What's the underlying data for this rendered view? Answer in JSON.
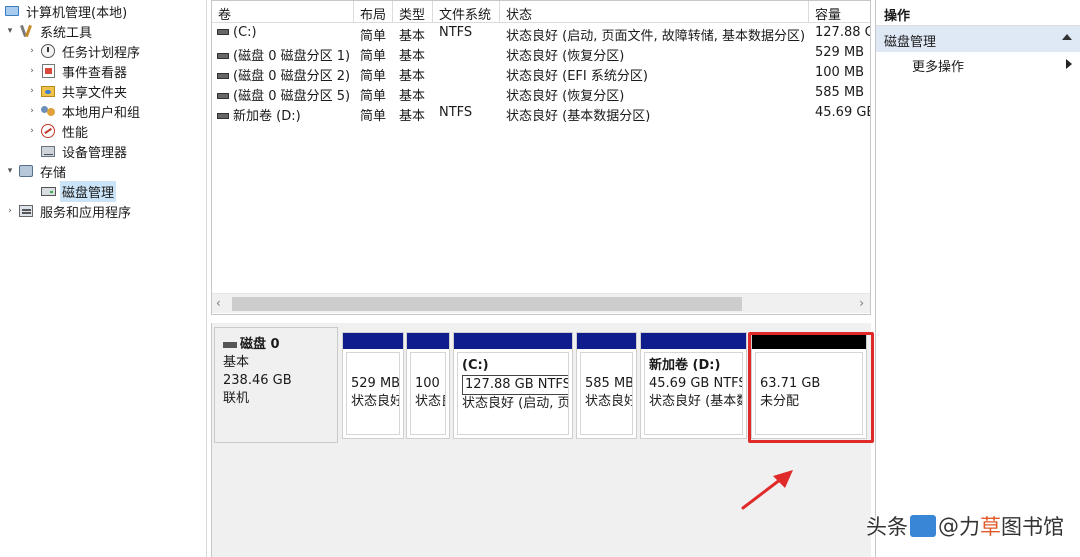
{
  "tree": {
    "items": [
      {
        "label": "计算机管理(本地)",
        "icon": "computer-icon",
        "level": 0,
        "expander": ""
      },
      {
        "label": "系统工具",
        "icon": "tools-icon",
        "level": 1,
        "expander": "expanded"
      },
      {
        "label": "任务计划程序",
        "icon": "clock-icon",
        "level": 2,
        "expander": "collapsed"
      },
      {
        "label": "事件查看器",
        "icon": "event-viewer-icon",
        "level": 2,
        "expander": "collapsed"
      },
      {
        "label": "共享文件夹",
        "icon": "shared-folder-icon",
        "level": 2,
        "expander": "collapsed"
      },
      {
        "label": "本地用户和组",
        "icon": "users-icon",
        "level": 2,
        "expander": "collapsed"
      },
      {
        "label": "性能",
        "icon": "performance-icon",
        "level": 2,
        "expander": "collapsed"
      },
      {
        "label": "设备管理器",
        "icon": "device-manager-icon",
        "level": 2,
        "expander": ""
      },
      {
        "label": "存储",
        "icon": "storage-icon",
        "level": 1,
        "expander": "expanded"
      },
      {
        "label": "磁盘管理",
        "icon": "disk-icon",
        "level": 2,
        "expander": "",
        "selected": true
      },
      {
        "label": "服务和应用程序",
        "icon": "services-icon",
        "level": 1,
        "expander": "collapsed"
      }
    ]
  },
  "volumes": {
    "columns": [
      "卷",
      "布局",
      "类型",
      "文件系统",
      "状态",
      "容量"
    ],
    "rows": [
      {
        "name": "(C:)",
        "layout": "简单",
        "type": "基本",
        "fs": "NTFS",
        "status": "状态良好 (启动, 页面文件, 故障转储, 基本数据分区)",
        "capacity": "127.88 G"
      },
      {
        "name": "(磁盘 0 磁盘分区 1)",
        "layout": "简单",
        "type": "基本",
        "fs": "",
        "status": "状态良好 (恢复分区)",
        "capacity": "529 MB"
      },
      {
        "name": "(磁盘 0 磁盘分区 2)",
        "layout": "简单",
        "type": "基本",
        "fs": "",
        "status": "状态良好 (EFI 系统分区)",
        "capacity": "100 MB"
      },
      {
        "name": "(磁盘 0 磁盘分区 5)",
        "layout": "简单",
        "type": "基本",
        "fs": "",
        "status": "状态良好 (恢复分区)",
        "capacity": "585 MB"
      },
      {
        "name": "新加卷 (D:)",
        "layout": "简单",
        "type": "基本",
        "fs": "NTFS",
        "status": "状态良好 (基本数据分区)",
        "capacity": "45.69 GB"
      }
    ],
    "scroll_left": "‹",
    "scroll_right": "›"
  },
  "disk": {
    "name": "磁盘 0",
    "type": "基本",
    "size": "238.46 GB",
    "state": "联机",
    "partitions": [
      {
        "title": "",
        "size": "529 MB",
        "status": "状态良好"
      },
      {
        "title": "",
        "size": "100 I",
        "status": "状态良"
      },
      {
        "title": "(C:)",
        "size": "127.88 GB NTFS",
        "status": "状态良好 (启动, 页"
      },
      {
        "title": "",
        "size": "585 MB",
        "status": "状态良好"
      },
      {
        "title": "新加卷 (D:)",
        "size": "45.69 GB NTFS",
        "status": "状态良好 (基本数"
      },
      {
        "title": "",
        "size": "63.71 GB",
        "status": "未分配"
      }
    ]
  },
  "actions": {
    "title": "操作",
    "section": "磁盘管理",
    "more": "更多操作"
  },
  "watermark": {
    "prefix": "头条",
    "at": "@",
    "name_a": "力",
    "name_hl": "草",
    "name_b": "图书馆"
  },
  "colors": {
    "partition_bar": "#0f1d8c",
    "unallocated_bar": "#000000",
    "highlight": "#e02a2a",
    "selection": "#cce4f7"
  }
}
